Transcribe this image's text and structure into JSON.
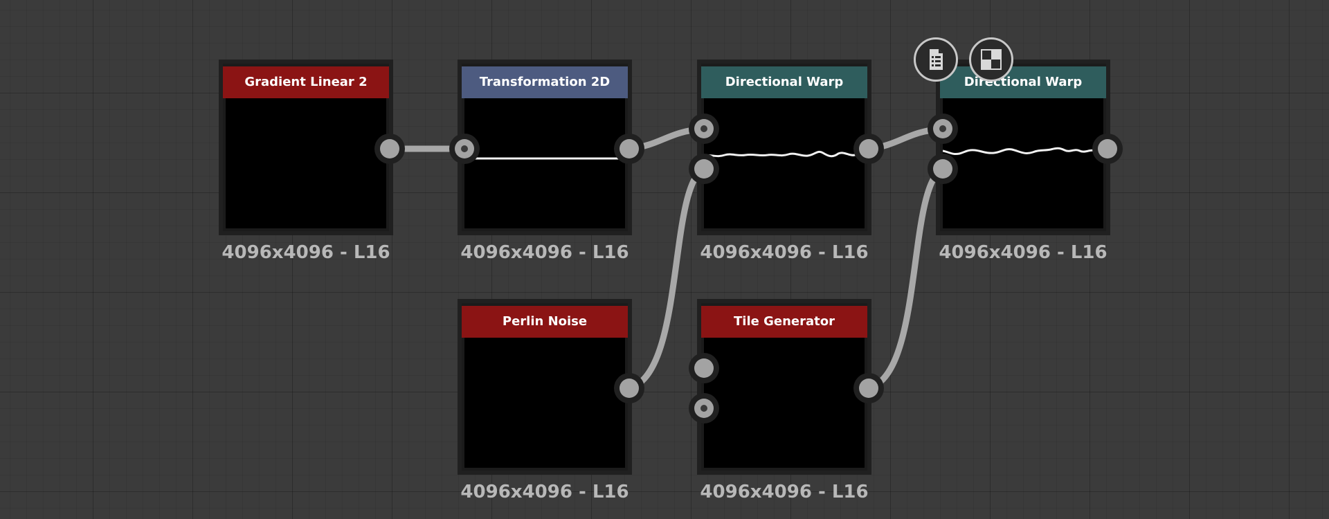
{
  "graph": {
    "nodes": [
      {
        "id": "gradient-linear-2",
        "title": "Gradient Linear 2",
        "caption": "4096x4096 - L16"
      },
      {
        "id": "transformation-2d",
        "title": "Transformation 2D",
        "caption": "4096x4096 - L16"
      },
      {
        "id": "directional-warp-1",
        "title": "Directional Warp",
        "caption": "4096x4096 - L16"
      },
      {
        "id": "directional-warp-2",
        "title": "Directional Warp",
        "caption": "4096x4096 - L16"
      },
      {
        "id": "perlin-noise",
        "title": "Perlin Noise",
        "caption": "4096x4096 - L16"
      },
      {
        "id": "tile-generator",
        "title": "Tile Generator",
        "caption": "4096x4096 - L16"
      }
    ]
  },
  "toolbar": {
    "icons": [
      "document-list-icon",
      "checker-preview-icon"
    ]
  },
  "colors": {
    "canvas": "#3b3b3b",
    "title_red": "#8b1414",
    "title_blue": "#4d5b80",
    "title_teal": "#2f5d5d",
    "pin": "#a3a3a3",
    "wire": "#a8a8a8",
    "caption": "#b8b8b8"
  }
}
